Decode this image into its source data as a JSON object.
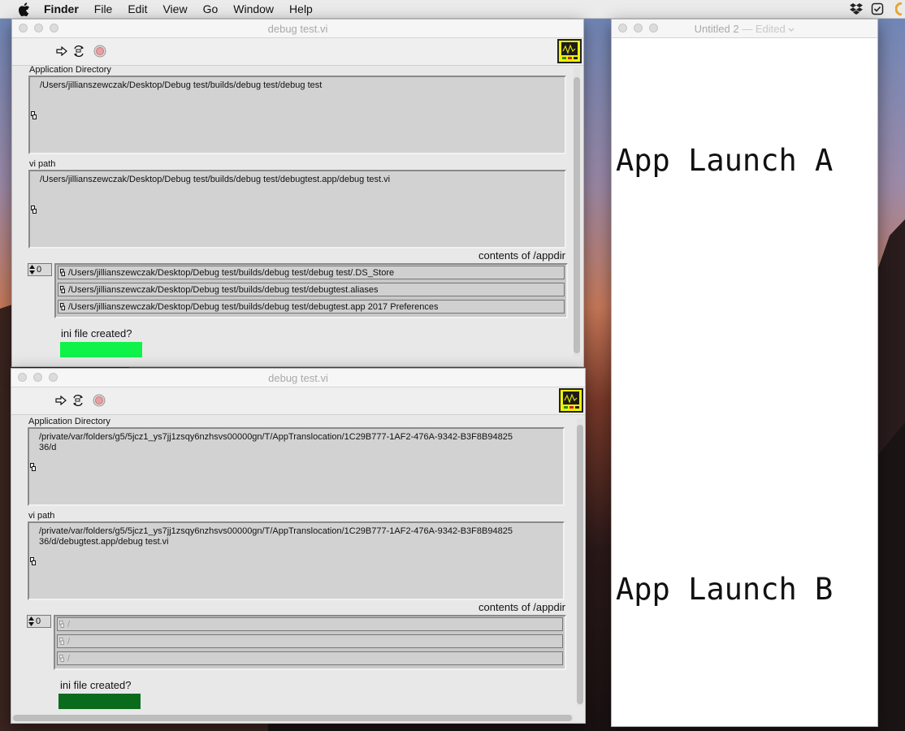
{
  "menubar": {
    "items": [
      "Finder",
      "File",
      "Edit",
      "View",
      "Go",
      "Window",
      "Help"
    ]
  },
  "window_a": {
    "title": "debug test.vi",
    "app_dir_label": "Application Directory",
    "app_dir_value": "/Users/jillianszewczak/Desktop/Debug test/builds/debug test/debug test",
    "vi_path_label": "vi path",
    "vi_path_value": "/Users/jillianszewczak/Desktop/Debug test/builds/debug test/debugtest.app/debug test.vi",
    "contents_label": "contents of /appdir",
    "index_value": "0",
    "contents": [
      "/Users/jillianszewczak/Desktop/Debug test/builds/debug test/debug test/.DS_Store",
      "/Users/jillianszewczak/Desktop/Debug test/builds/debug test/debugtest.aliases",
      "/Users/jillianszewczak/Desktop/Debug test/builds/debug test/debugtest.app 2017 Preferences"
    ],
    "ini_label": "ini file created?",
    "ini_led_color": "#0ef24a"
  },
  "window_b": {
    "title": "debug test.vi",
    "app_dir_label": "Application Directory",
    "app_dir_value": "/private/var/folders/g5/5jcz1_ys7jj1zsqy6nzhsvs00000gn/T/AppTranslocation/1C29B777-1AF2-476A-9342-B3F8B9482536/d",
    "vi_path_label": "vi path",
    "vi_path_value": "/private/var/folders/g5/5jcz1_ys7jj1zsqy6nzhsvs00000gn/T/AppTranslocation/1C29B777-1AF2-476A-9342-B3F8B9482536/d/debugtest.app/debug test.vi",
    "contents_label": "contents of /appdir",
    "index_value": "0",
    "contents": [
      "/",
      "/",
      "/"
    ],
    "ini_label": "ini file created?",
    "ini_led_color": "#0b6b1d"
  },
  "textedit": {
    "title": "Untitled 2",
    "edited": "— Edited",
    "line_a": "App Launch A",
    "line_b": "App Launch B"
  }
}
